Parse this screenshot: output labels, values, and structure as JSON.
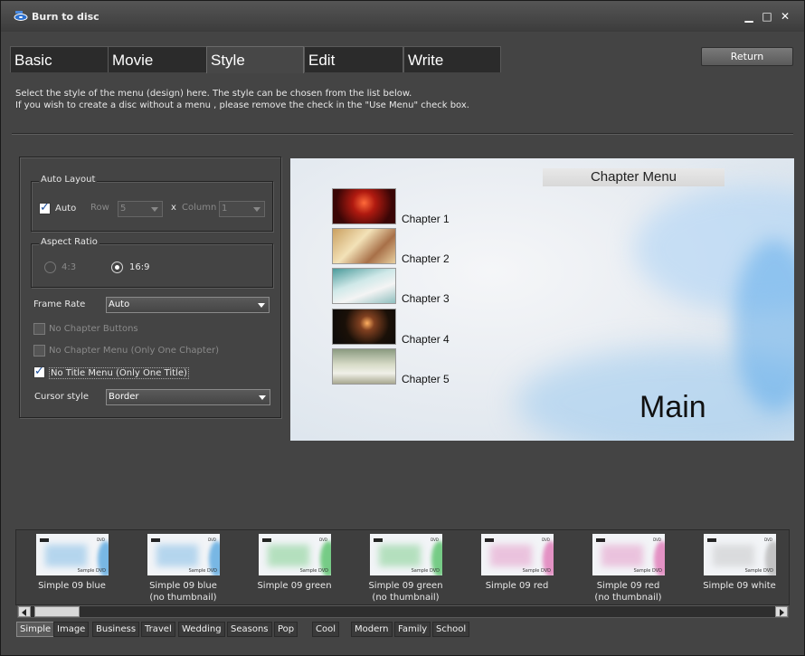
{
  "window": {
    "title": "Burn to disc",
    "minimize": "▁",
    "maximize": "□",
    "close": "✕"
  },
  "tabs": [
    "Basic",
    "Movie",
    "Style",
    "Edit",
    "Write"
  ],
  "active_tab": "Style",
  "return_button": "Return",
  "description": [
    "Select the style of the menu (design) here. The style can be chosen from the list below.",
    "If you wish to create a disc without a menu , please remove the check in the \"Use Menu\" check box."
  ],
  "auto_layout": {
    "legend": "Auto Layout",
    "auto_label": "Auto",
    "auto_checked": true,
    "row_label": "Row",
    "row_value": "5",
    "x_label": "x",
    "column_label": "Column",
    "column_value": "1"
  },
  "aspect_ratio": {
    "legend": "Aspect Ratio",
    "option_43": "4:3",
    "option_169": "16:9",
    "selected": "16:9"
  },
  "frame_rate": {
    "label": "Frame Rate",
    "value": "Auto"
  },
  "checkboxes": {
    "no_chapter_buttons": "No Chapter Buttons",
    "no_chapter_menu": "No Chapter Menu (Only One Chapter)",
    "no_title_menu": "No Title Menu (Only One Title)"
  },
  "cursor_style": {
    "label": "Cursor style",
    "value": "Border"
  },
  "preview": {
    "title": "Chapter Menu",
    "chapters": [
      "Chapter 1",
      "Chapter 2",
      "Chapter 3",
      "Chapter 4",
      "Chapter 5"
    ],
    "main_label": "Main"
  },
  "styles": [
    {
      "name": "Simple 09 blue",
      "sub": "",
      "accent": "#5aa8e0"
    },
    {
      "name": "Simple 09 blue",
      "sub": "(no thumbnail)",
      "accent": "#5aa8e0"
    },
    {
      "name": "Simple 09 green",
      "sub": "",
      "accent": "#58c26a"
    },
    {
      "name": "Simple 09 green",
      "sub": "(no thumbnail)",
      "accent": "#58c26a"
    },
    {
      "name": "Simple 09 red",
      "sub": "",
      "accent": "#e07ab8"
    },
    {
      "name": "Simple 09 red",
      "sub": "(no thumbnail)",
      "accent": "#e07ab8"
    },
    {
      "name": "Simple 09 white",
      "sub": "",
      "accent": "#b8b8b8"
    }
  ],
  "style_thumb_text": {
    "dvd": "DVD",
    "sample": "Sample DVD"
  },
  "categories": [
    "Simple",
    "Image",
    "Business",
    "Travel",
    "Wedding",
    "Seasons",
    "Pop",
    "Cool",
    "Modern",
    "Family",
    "School"
  ],
  "active_category": "Simple"
}
